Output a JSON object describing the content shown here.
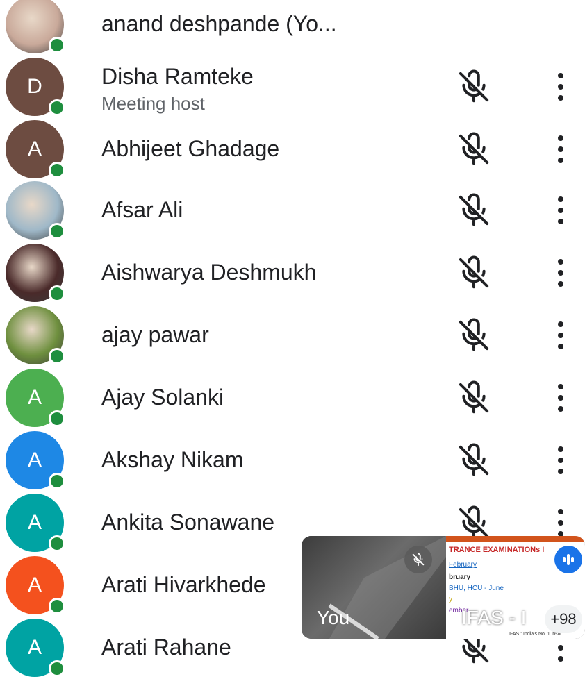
{
  "participants": [
    {
      "name": "anand deshpande (Yo...",
      "subtitle": "",
      "initial": "",
      "avatar_color": "#c9a99a",
      "photo": true
    },
    {
      "name": "Disha Ramteke",
      "subtitle": "Meeting host",
      "initial": "D",
      "avatar_color": "#6d4c41"
    },
    {
      "name": "Abhijeet Ghadage",
      "subtitle": "",
      "initial": "A",
      "avatar_color": "#6d4c41"
    },
    {
      "name": "Afsar Ali",
      "subtitle": "",
      "initial": "",
      "avatar_color": "#9fb8c8",
      "photo": true
    },
    {
      "name": "Aishwarya Deshmukh",
      "subtitle": "",
      "initial": "",
      "avatar_color": "#4a2a2a",
      "photo": true
    },
    {
      "name": "ajay pawar",
      "subtitle": "",
      "initial": "",
      "avatar_color": "#6e8f3e",
      "photo": true
    },
    {
      "name": "Ajay Solanki",
      "subtitle": "",
      "initial": "A",
      "avatar_color": "#4caf50"
    },
    {
      "name": "Akshay Nikam",
      "subtitle": "",
      "initial": "A",
      "avatar_color": "#1e88e5"
    },
    {
      "name": "Ankita Sonawane",
      "subtitle": "",
      "initial": "A",
      "avatar_color": "#00a3a3"
    },
    {
      "name": "Arati Hivarkhede",
      "subtitle": "",
      "initial": "A",
      "avatar_color": "#f4511e"
    },
    {
      "name": "Arati Rahane",
      "subtitle": "",
      "initial": "A",
      "avatar_color": "#00a3a3"
    }
  ],
  "icons": {
    "mic": "mic-off-icon",
    "more": "more-vert-icon",
    "status": "online-dot-icon"
  },
  "colors": {
    "online": "#1e8e3e",
    "text": "#202124",
    "subtext": "#5f6368"
  },
  "pip": {
    "self_label": "You",
    "share_label": "IFAS - I",
    "others_count": "+98",
    "share_lines": [
      "TRANCE EXAMINATIONs I",
      "February",
      "bruary",
      "BHU, HCU - June",
      "y",
      "ember",
      "IFAS : India's No. 1 instit"
    ]
  }
}
